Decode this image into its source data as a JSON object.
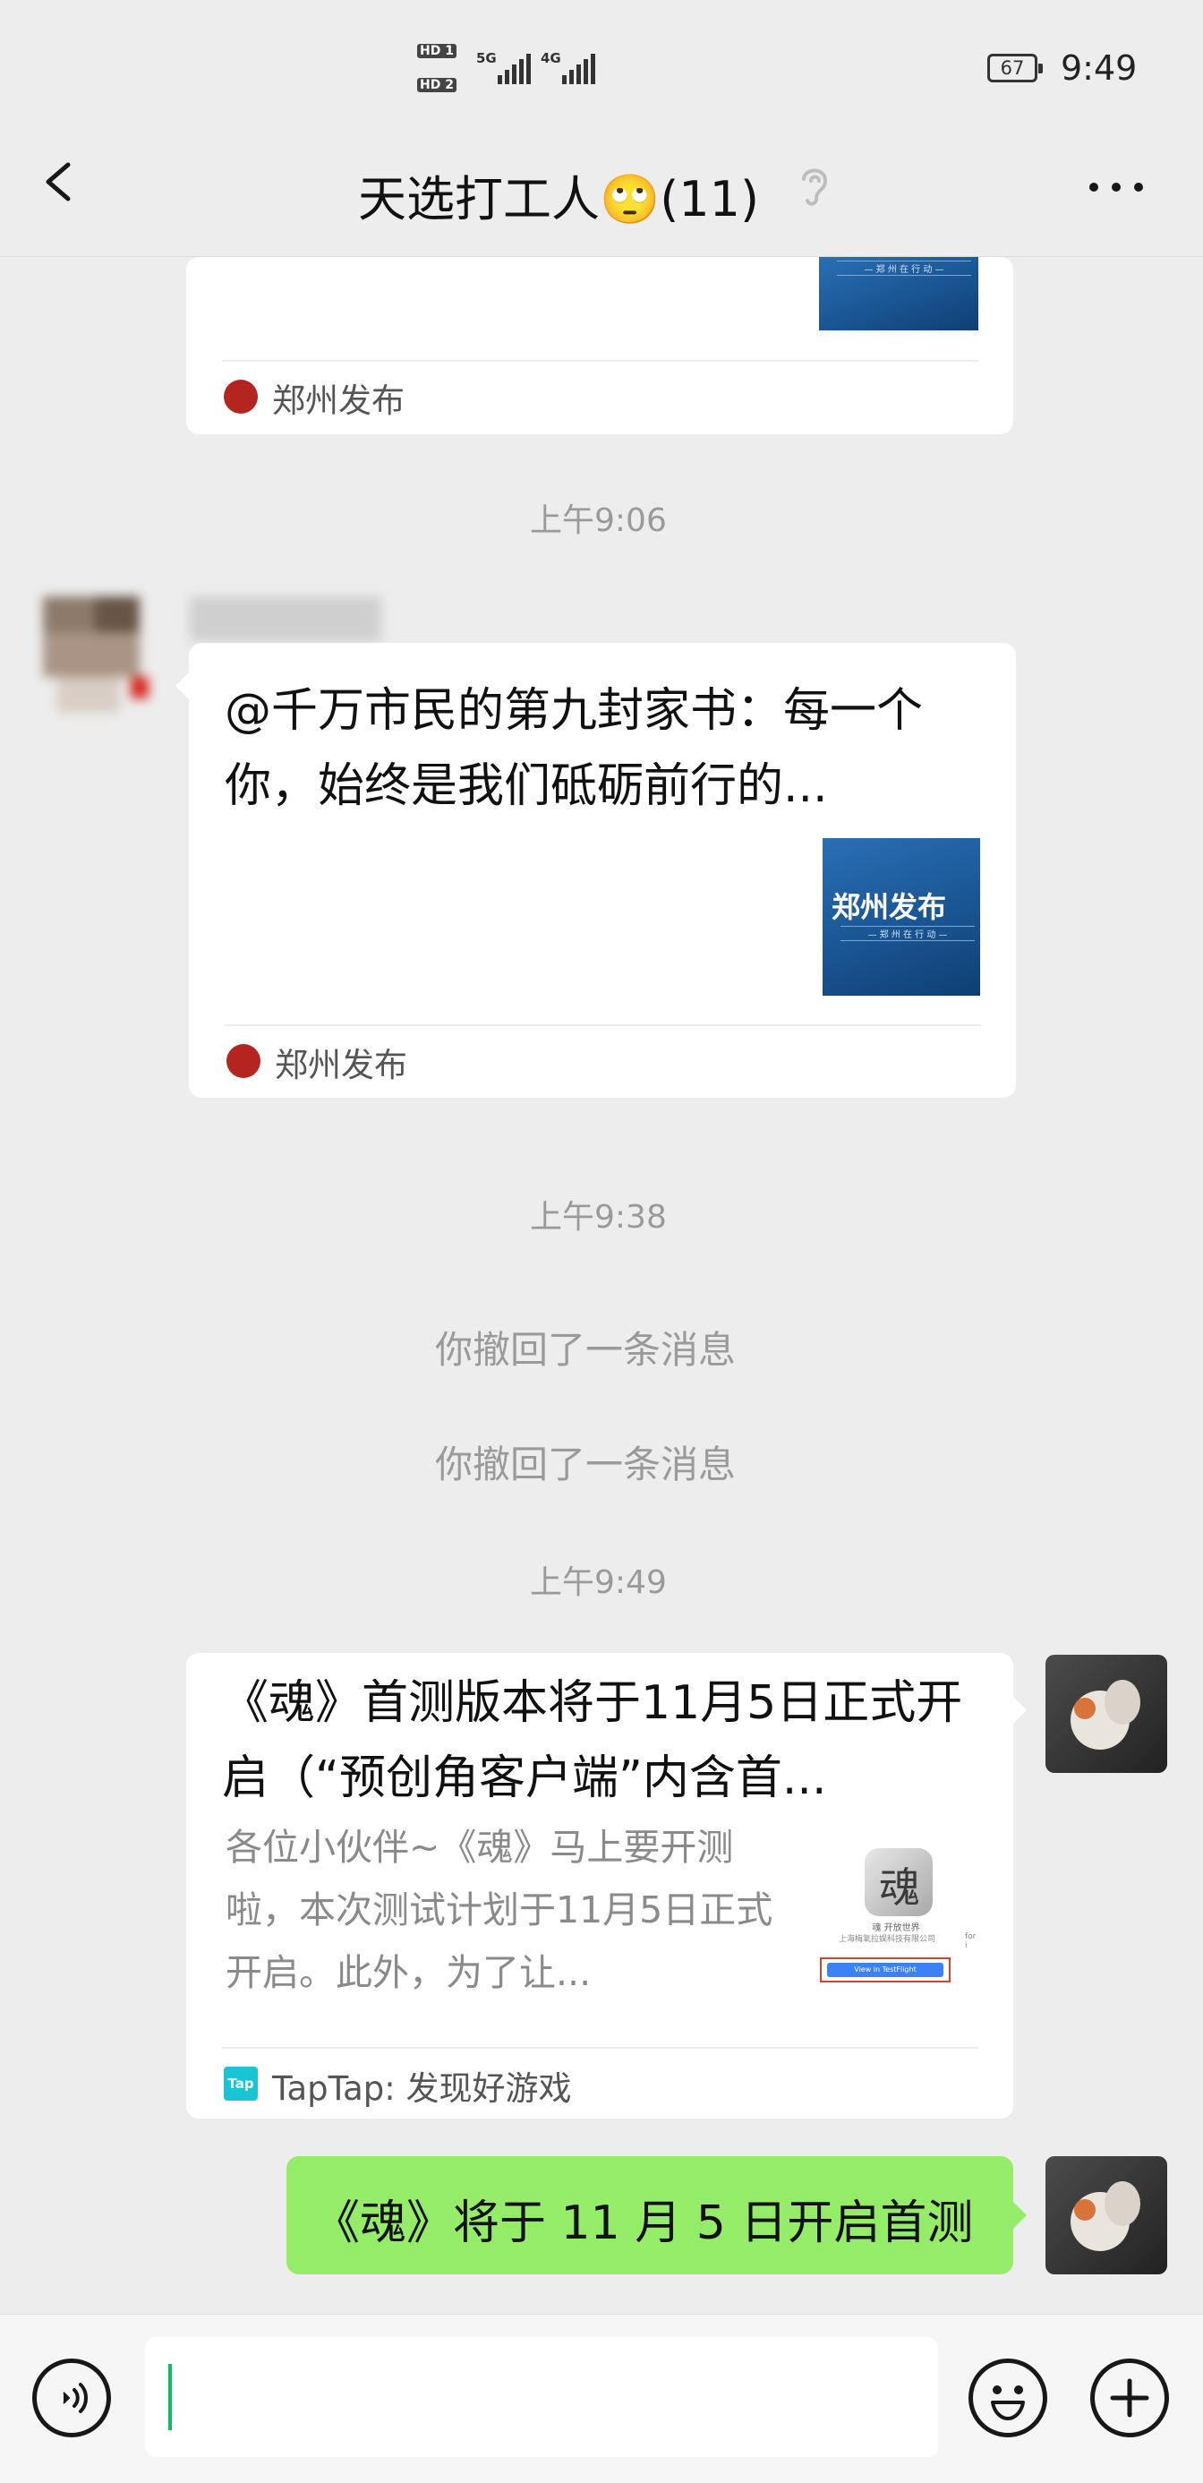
{
  "status_bar": {
    "sim1": "HD 1",
    "sim2": "HD 2",
    "net1": "5G",
    "net2": "4G",
    "battery": "67",
    "time": "9:49"
  },
  "header": {
    "back_icon": "chevron-left-icon",
    "title": "天选打工人🙄(11)",
    "earpiece_icon": "ear-icon",
    "more_icon": "more-dots-icon"
  },
  "messages": {
    "card_top": {
      "source": "郑州发布"
    },
    "time1": "上午9:06",
    "card_zz": {
      "title": "@千万市民的第九封家书：每一个你，始终是我们砥砺前行的...",
      "thumb_text": "郑州发布",
      "thumb_sub": "— 郑 州 在 行 动 —",
      "source": "郑州发布"
    },
    "time2": "上午9:38",
    "recall1": "你撤回了一条消息",
    "recall2": "你撤回了一条消息",
    "time3": "上午9:49",
    "card_taptap": {
      "title": "《魂》首测版本将于11月5日正式开启（“预创角客户端”内含首...",
      "desc": "各位小伙伴~《魂》马上要开测啦，本次测试计划于11月5日正式开启。此外，为了让...",
      "thumb_app": "魂 开放世界",
      "thumb_company": "上海梅氧拉娱科技有限公司",
      "thumb_for": "for i",
      "thumb_button": "View in TestFlight",
      "source_icon": "Tap",
      "source": "TapTap: 发现好游戏"
    },
    "bubble_text": "《魂》将于 11 月 5 日开启首测"
  },
  "input_bar": {
    "voice_icon": "voice-icon",
    "emoji_icon": "emoji-icon",
    "plus_icon": "plus-icon"
  },
  "colors": {
    "background": "#ededed",
    "bubble_green": "#95ec69",
    "caret": "#07c160",
    "source_red": "#b3251e",
    "taptap_cyan": "#19c4d4"
  }
}
